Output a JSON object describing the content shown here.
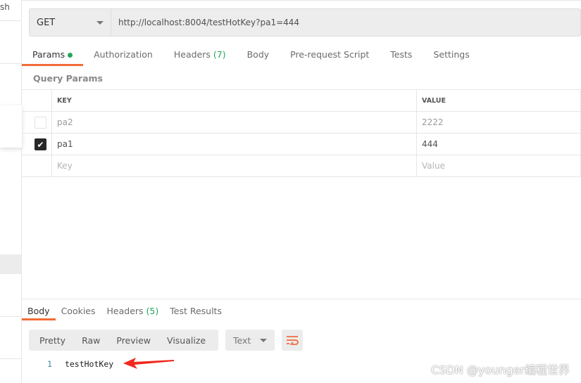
{
  "sidebar": {
    "partial_text": "sh"
  },
  "request": {
    "method": "GET",
    "url": "http://localhost:8004/testHotKey?pa1=444"
  },
  "tabs": [
    {
      "label": "Params"
    },
    {
      "label": "Authorization"
    },
    {
      "label": "Headers",
      "count": "(7)"
    },
    {
      "label": "Body"
    },
    {
      "label": "Pre-request Script"
    },
    {
      "label": "Tests"
    },
    {
      "label": "Settings"
    }
  ],
  "query_params": {
    "title": "Query Params",
    "columns": [
      "KEY",
      "VALUE"
    ],
    "rows": [
      {
        "key": "pa2",
        "value": "2222",
        "checked": false
      },
      {
        "key": "pa1",
        "value": "444",
        "checked": true
      }
    ],
    "placeholder_key": "Key",
    "placeholder_value": "Value"
  },
  "response": {
    "tabs": [
      {
        "label": "Body"
      },
      {
        "label": "Cookies"
      },
      {
        "label": "Headers",
        "count": "(5)"
      },
      {
        "label": "Test Results"
      }
    ],
    "views": [
      "Pretty",
      "Raw",
      "Preview",
      "Visualize"
    ],
    "format": "Text",
    "lines": [
      {
        "n": "1",
        "text": "testHotKey"
      }
    ]
  },
  "watermark": "CSDN @younger编程世界",
  "colors": {
    "accent": "#f26b3a",
    "green": "#26a65b",
    "arrow": "#f0281e"
  }
}
